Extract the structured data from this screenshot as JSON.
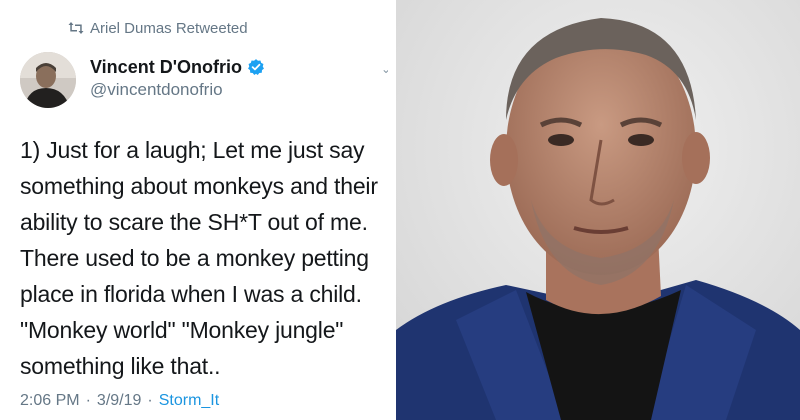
{
  "retweet": {
    "icon": "retweet-icon",
    "text": "Ariel Dumas Retweeted"
  },
  "author": {
    "name": "Vincent D'Onofrio",
    "handle": "@vincentdonofrio",
    "verified_icon": "verified-badge-icon",
    "verified_color": "#1da1f2"
  },
  "tweet": {
    "lines": [
      "1) Just for a laugh; Let me just say",
      "something about monkeys and their",
      "ability to scare the SH*T out of me.",
      "There used to be a monkey petting",
      "place in florida when I was a child.",
      "\"Monkey world\" \"Monkey jungle\"",
      "something like that.."
    ],
    "time": "2:06 PM",
    "separator": "·",
    "date": "3/9/19",
    "source": "Storm_It"
  },
  "colors": {
    "text_primary": "#14171a",
    "text_secondary": "#657786",
    "link": "#1b95e0",
    "photo_background": "#e6e6e6",
    "jacket": "#1f3470"
  }
}
